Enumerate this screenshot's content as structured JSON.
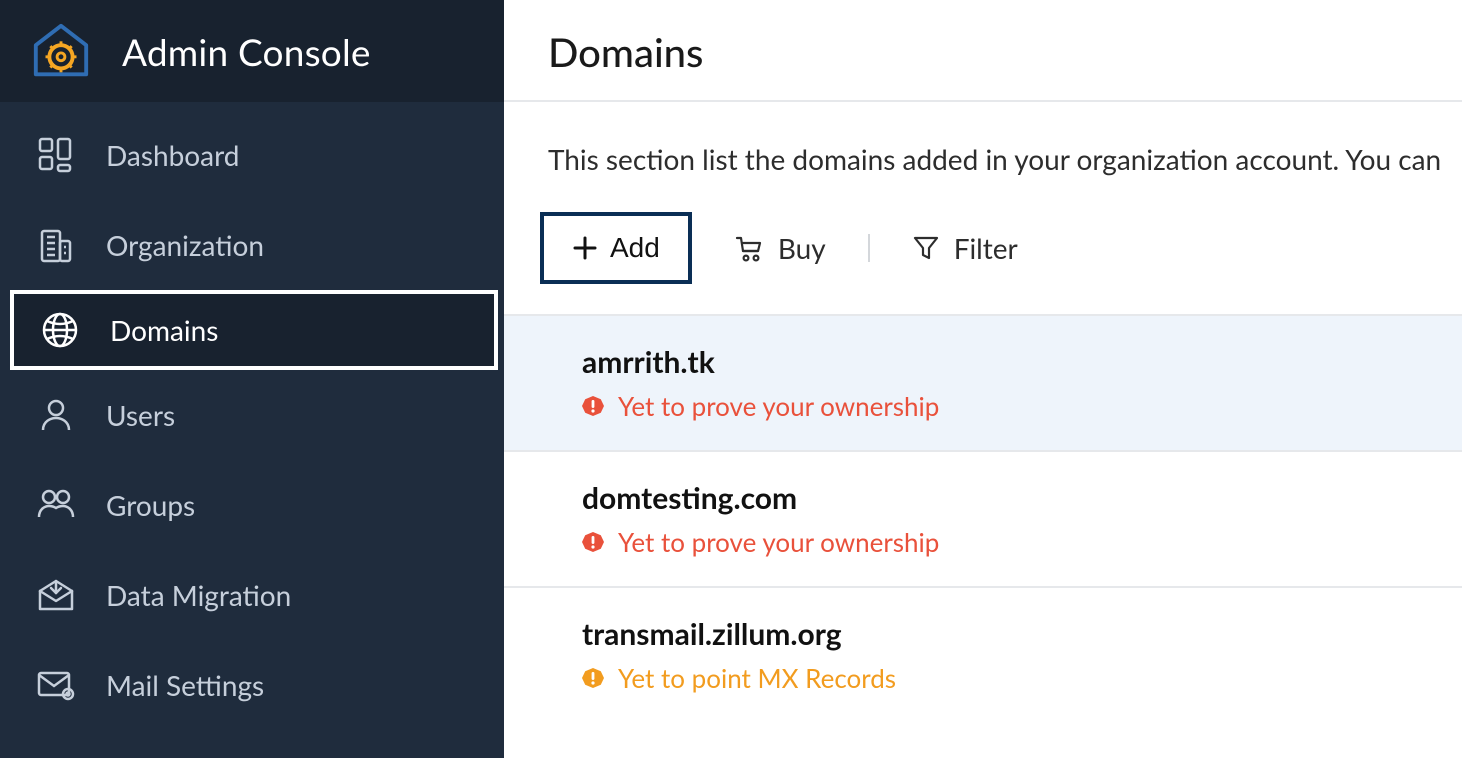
{
  "sidebar": {
    "title": "Admin Console",
    "items": [
      {
        "label": "Dashboard"
      },
      {
        "label": "Organization"
      },
      {
        "label": "Domains"
      },
      {
        "label": "Users"
      },
      {
        "label": "Groups"
      },
      {
        "label": "Data Migration"
      },
      {
        "label": "Mail Settings"
      }
    ]
  },
  "main": {
    "title": "Domains",
    "description": "This section list the domains added in your organization account. You can",
    "toolbar": {
      "add": "Add",
      "buy": "Buy",
      "filter": "Filter"
    },
    "domains": [
      {
        "name": "amrrith.tk",
        "status": "Yet to prove your ownership",
        "status_kind": "red"
      },
      {
        "name": "domtesting.com",
        "status": "Yet to prove your ownership",
        "status_kind": "red"
      },
      {
        "name": "transmail.zillum.org",
        "status": "Yet to point MX Records",
        "status_kind": "orange"
      }
    ]
  },
  "colors": {
    "sidebar_bg": "#1f2c3d",
    "sidebar_dark": "#18222f",
    "accent_outline": "#0a2e55",
    "status_red": "#e9513b",
    "status_orange": "#f29c1f"
  }
}
